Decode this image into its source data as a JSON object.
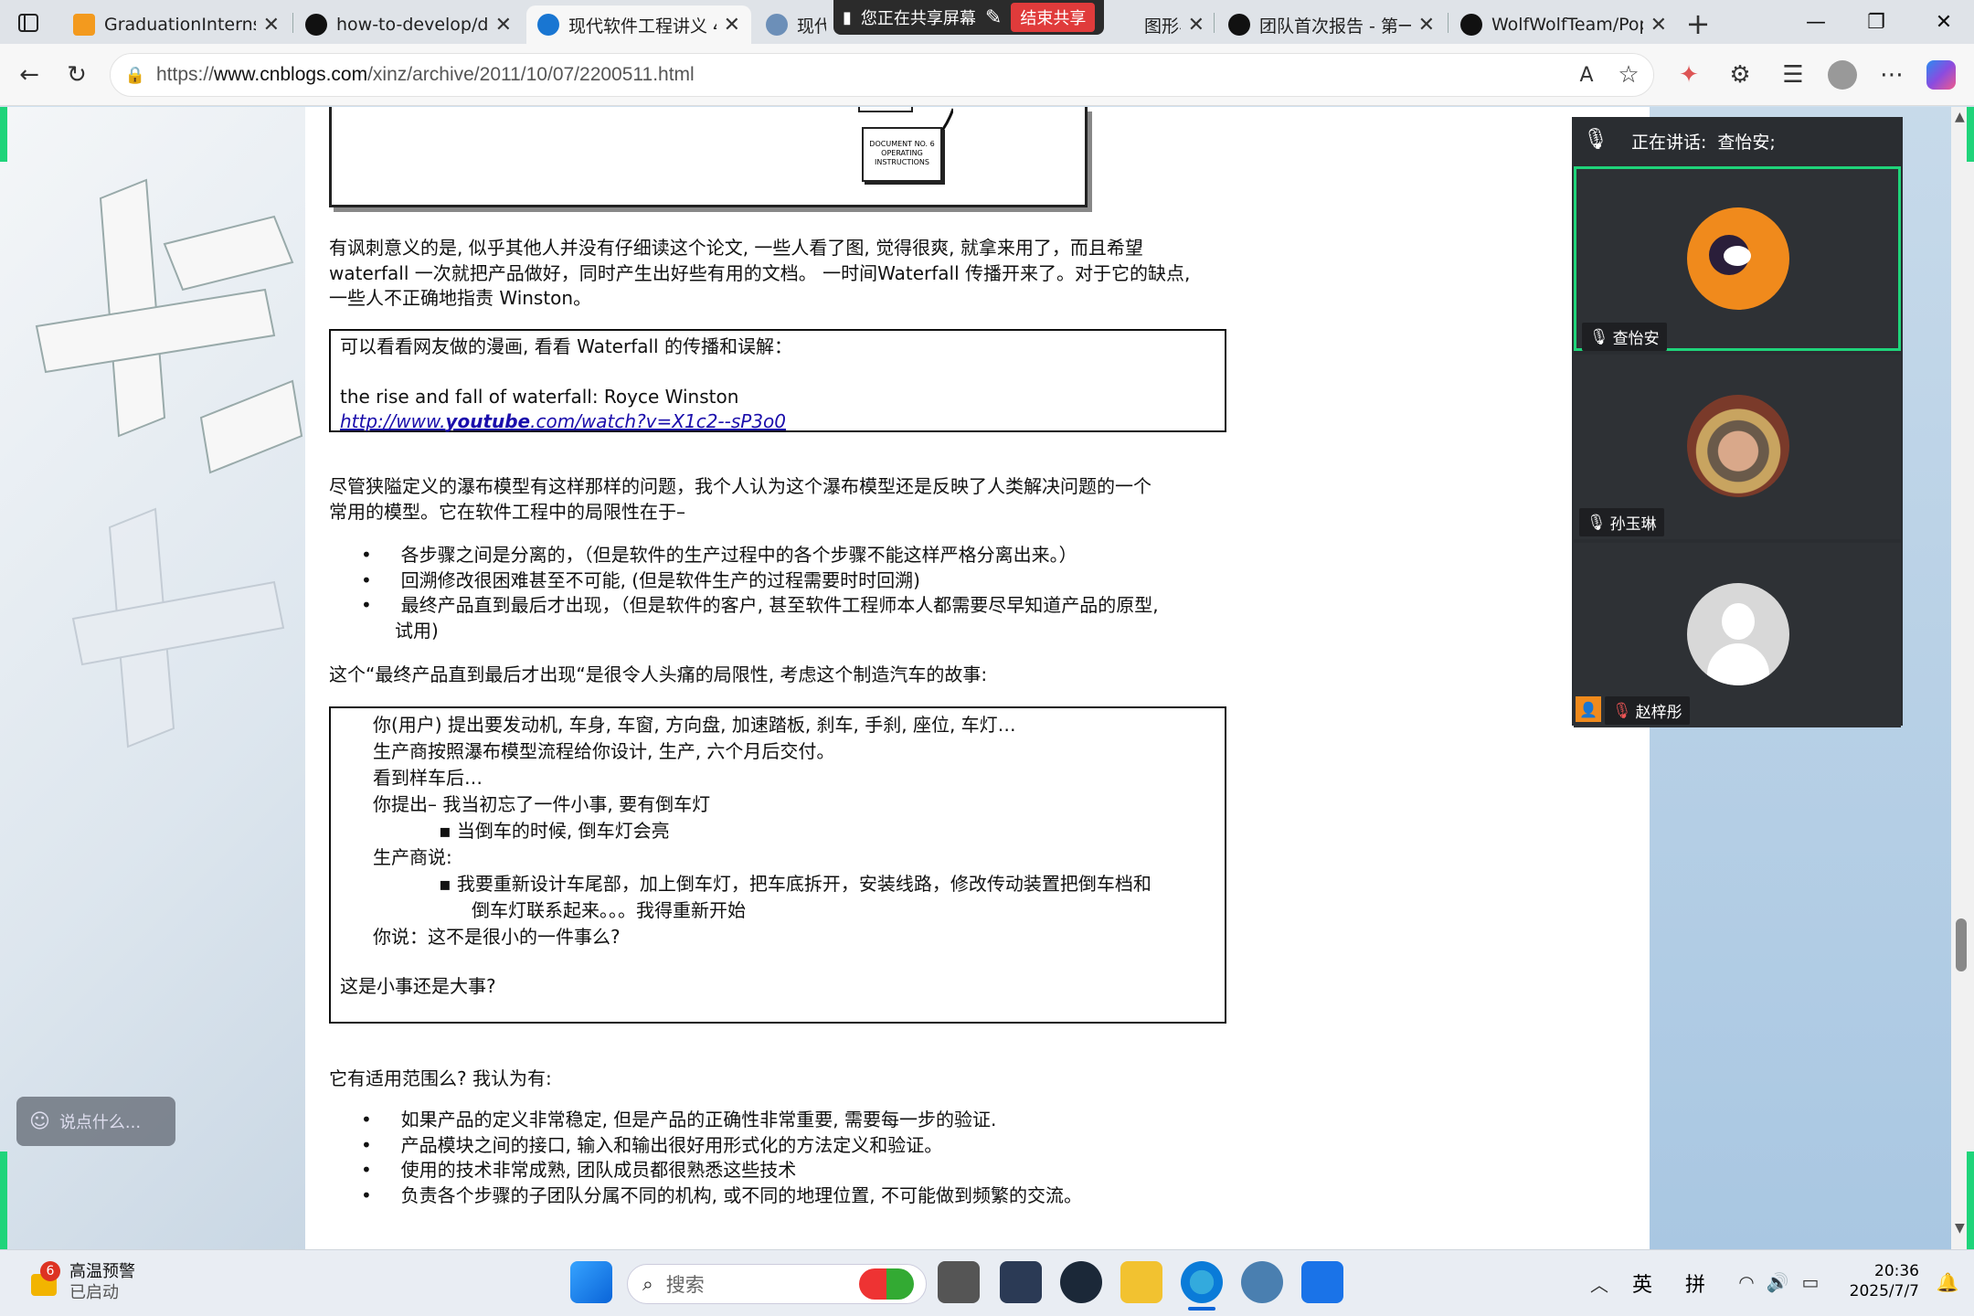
{
  "tabs": [
    {
      "label": "GraduationInternshi",
      "active": false
    },
    {
      "label": "how-to-develop/do",
      "active": false
    },
    {
      "label": "现代软件工程讲义 4",
      "active": true
    },
    {
      "label": "现代",
      "active": false
    },
    {
      "label": "图形界",
      "active": false
    },
    {
      "label": "团队首次报告 - 第一",
      "active": false
    },
    {
      "label": "WolfWolfTeam/Pop(",
      "active": false
    }
  ],
  "share_banner": {
    "status": "您正在共享屏幕",
    "stop": "结束共享"
  },
  "address": {
    "url_prefix": "https://",
    "url_host": "www.cnblogs.com",
    "url_path": "/xinz/archive/2011/10/07/2200511.html"
  },
  "article": {
    "figure_labels": [
      "DOCUMENT NO. 6",
      "OPERATING",
      "INSTRUCTIONS"
    ],
    "p1": [
      "有讽刺意义的是, 似乎其他人并没有仔细读这个论文, 一些人看了图, 觉得很爽, 就拿来用了，而且希望",
      "waterfall 一次就把产品做好，同时产生出好些有用的文档。 一时间Waterfall 传播开来了。对于它的缺点,",
      "一些人不正确地指责 Winston。"
    ],
    "box1": {
      "line1": "可以看看网友做的漫画, 看看 Waterfall 的传播和误解：",
      "line2": "the rise and fall of waterfall:  Royce Winston",
      "link_pre": "http://www.",
      "link_bold": "youtube",
      "link_post": ".com/watch?v=X1c2--sP3o0"
    },
    "p2": [
      "尽管狭隘定义的瀑布模型有这样那样的问题，我个人认为这个瀑布模型还是反映了人类解决问题的一个",
      "常用的模型。它在软件工程中的局限性在于–"
    ],
    "bullets1": [
      "各步骤之间是分离的，（但是软件的生产过程中的各个步骤不能这样严格分离出来。）",
      "回溯修改很困难甚至不可能, (但是软件生产的过程需要时时回溯)",
      "最终产品直到最后才出现，（但是软件的客户, 甚至软件工程师本人都需要尽早知道产品的原型,"
    ],
    "bullets1_cont": "试用)",
    "p3": "这个“最终产品直到最后才出现“是很令人头痛的局限性, 考虑这个制造汽车的故事:",
    "box2": [
      "你(用户) 提出要发动机, 车身, 车窗, 方向盘, 加速踏板, 刹车, 手刹, 座位, 车灯…",
      "生产商按照瀑布模型流程给你设计, 生产, 六个月后交付。",
      "看到样车后…",
      "你提出– 我当初忘了一件小事, 要有倒车灯",
      "当倒车的时候, 倒车灯会亮",
      "生产商说:",
      "我要重新设计车尾部，加上倒车灯，把车底拆开，安装线路，修改传动装置把倒车档和",
      "倒车灯联系起来。。。我得重新开始",
      "你说：这不是很小的一件事么?",
      "这是小事还是大事?"
    ],
    "p4": "它有适用范围么? 我认为有:",
    "bullets2": [
      "如果产品的定义非常稳定, 但是产品的正确性非常重要, 需要每一步的验证.",
      "产品模块之间的接口, 输入和输出很好用形式化的方法定义和验证。",
      "使用的技术非常成熟, 团队成员都很熟悉这些技术",
      "负责各个步骤的子团队分属不同的机构, 或不同的地理位置, 不可能做到频繁的交流。"
    ]
  },
  "meeting": {
    "speaking_label": "正在讲话:",
    "speaking_name": "查怡安;",
    "participants": [
      "查怡安",
      "孙玉琳",
      "赵梓彤"
    ]
  },
  "chat_placeholder": "说点什么...",
  "taskbar": {
    "alert_count": "6",
    "alert_title": "高温预警",
    "alert_sub": "已启动",
    "search": "搜索",
    "ime1": "英",
    "ime2": "拼",
    "time": "20:36",
    "date": "2025/7/7"
  },
  "colors": {
    "accent": "#1fd47a",
    "stop": "#e03b3b",
    "link": "#1a0dab"
  }
}
